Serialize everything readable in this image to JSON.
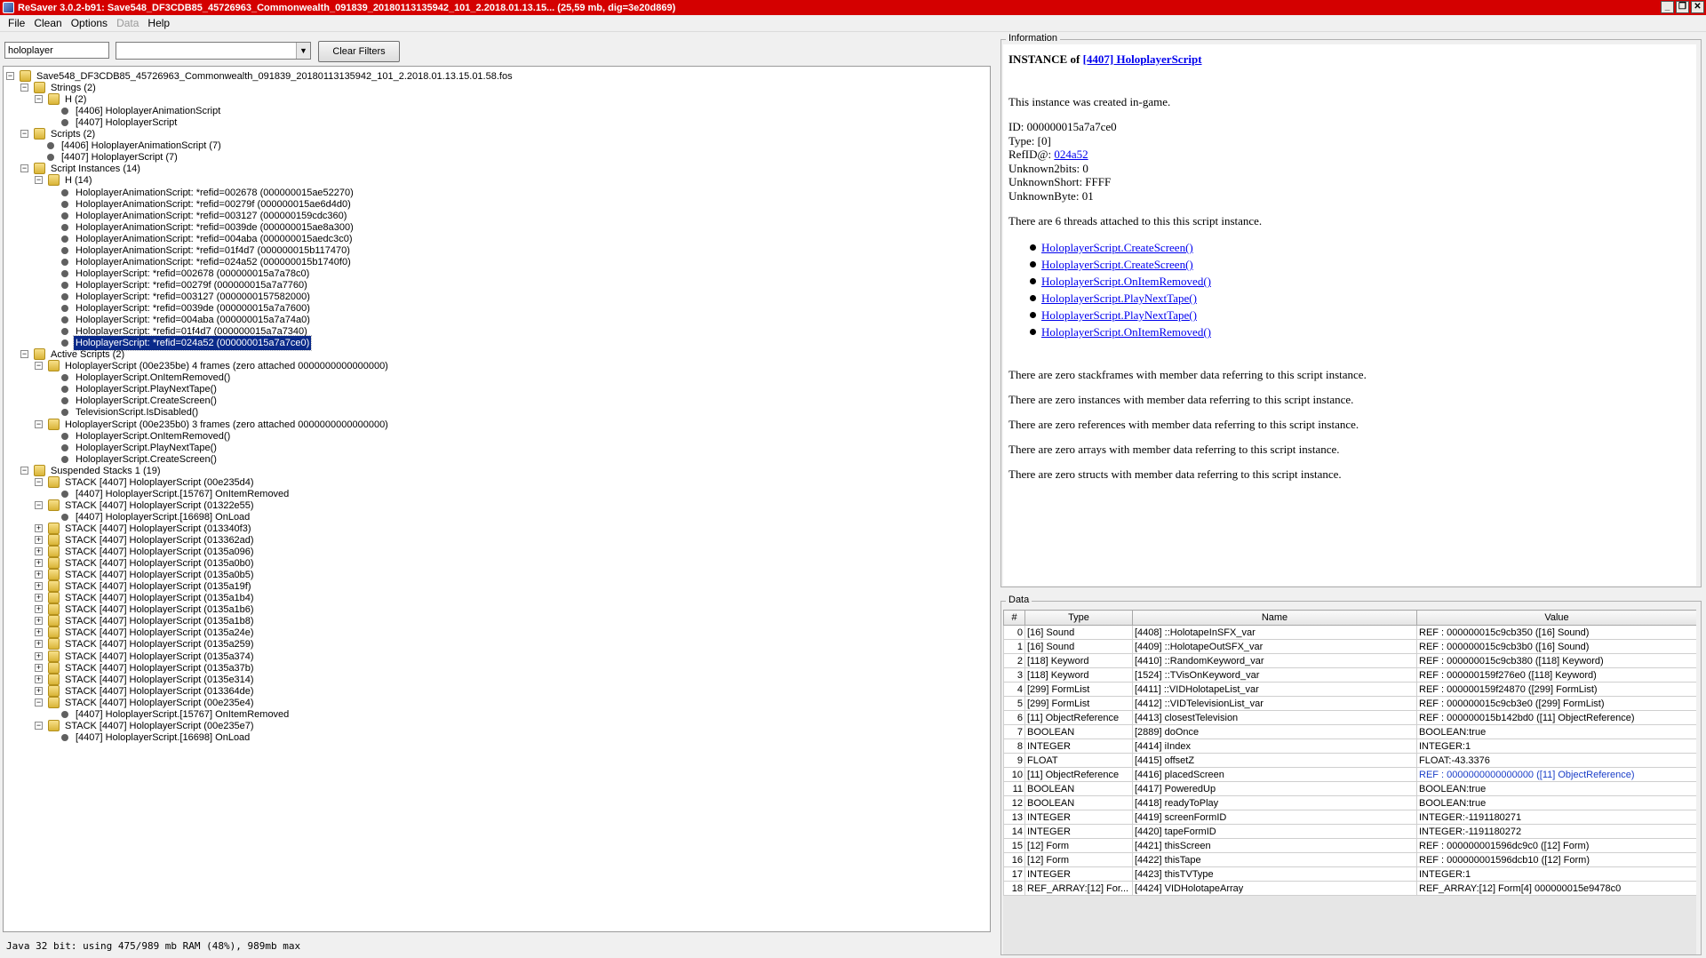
{
  "window": {
    "title": "ReSaver 3.0.2-b91: Save548_DF3CDB85_45726963_Commonwealth_091839_20180113135942_101_2.2018.01.13.15... (25,59 mb, dig=3e20d869)",
    "controls": [
      "_",
      "❐",
      "✕"
    ]
  },
  "menu": [
    {
      "label": "File",
      "enabled": true
    },
    {
      "label": "Clean",
      "enabled": true
    },
    {
      "label": "Options",
      "enabled": true
    },
    {
      "label": "Data",
      "enabled": false
    },
    {
      "label": "Help",
      "enabled": true
    }
  ],
  "filter": {
    "value": "holoplayer",
    "select_value": "",
    "clear_label": "Clear Filters"
  },
  "tree": [
    {
      "d": 0,
      "t": "f",
      "e": "-",
      "l": "Save548_DF3CDB85_45726963_Commonwealth_091839_20180113135942_101_2.2018.01.13.15.01.58.fos"
    },
    {
      "d": 1,
      "t": "f",
      "e": "-",
      "l": "Strings (2)"
    },
    {
      "d": 2,
      "t": "f",
      "e": "-",
      "l": "H (2)"
    },
    {
      "d": 3,
      "t": "l",
      "l": "[4406] HoloplayerAnimationScript"
    },
    {
      "d": 3,
      "t": "l",
      "l": "[4407] HoloplayerScript"
    },
    {
      "d": 1,
      "t": "f",
      "e": "-",
      "l": "Scripts (2)"
    },
    {
      "d": 2,
      "t": "l",
      "l": "[4406] HoloplayerAnimationScript (7)"
    },
    {
      "d": 2,
      "t": "l",
      "l": "[4407] HoloplayerScript (7)"
    },
    {
      "d": 1,
      "t": "f",
      "e": "-",
      "l": "Script Instances (14)"
    },
    {
      "d": 2,
      "t": "f",
      "e": "-",
      "l": "H (14)"
    },
    {
      "d": 3,
      "t": "l",
      "l": "HoloplayerAnimationScript: *refid=002678 (000000015ae52270)"
    },
    {
      "d": 3,
      "t": "l",
      "l": "HoloplayerAnimationScript: *refid=00279f (000000015ae6d4d0)"
    },
    {
      "d": 3,
      "t": "l",
      "l": "HoloplayerAnimationScript: *refid=003127 (000000159cdc360)"
    },
    {
      "d": 3,
      "t": "l",
      "l": "HoloplayerAnimationScript: *refid=0039de (000000015ae8a300)"
    },
    {
      "d": 3,
      "t": "l",
      "l": "HoloplayerAnimationScript: *refid=004aba (000000015aedc3c0)"
    },
    {
      "d": 3,
      "t": "l",
      "l": "HoloplayerAnimationScript: *refid=01f4d7 (000000015b117470)"
    },
    {
      "d": 3,
      "t": "l",
      "l": "HoloplayerAnimationScript: *refid=024a52 (000000015b1740f0)"
    },
    {
      "d": 3,
      "t": "l",
      "l": "HoloplayerScript: *refid=002678 (000000015a7a78c0)"
    },
    {
      "d": 3,
      "t": "l",
      "l": "HoloplayerScript: *refid=00279f (000000015a7a7760)"
    },
    {
      "d": 3,
      "t": "l",
      "l": "HoloplayerScript: *refid=003127 (0000000157582000)"
    },
    {
      "d": 3,
      "t": "l",
      "l": "HoloplayerScript: *refid=0039de (000000015a7a7600)"
    },
    {
      "d": 3,
      "t": "l",
      "l": "HoloplayerScript: *refid=004aba (000000015a7a74a0)"
    },
    {
      "d": 3,
      "t": "l",
      "l": "HoloplayerScript: *refid=01f4d7 (000000015a7a7340)"
    },
    {
      "d": 3,
      "t": "l",
      "l": "HoloplayerScript: *refid=024a52 (000000015a7a7ce0)",
      "sel": true
    },
    {
      "d": 1,
      "t": "f",
      "e": "-",
      "l": "Active Scripts (2)"
    },
    {
      "d": 2,
      "t": "f",
      "e": "-",
      "l": "HoloplayerScript (00e235be) 4 frames (zero attached 0000000000000000)"
    },
    {
      "d": 3,
      "t": "l",
      "l": "HoloplayerScript.OnItemRemoved()"
    },
    {
      "d": 3,
      "t": "l",
      "l": "HoloplayerScript.PlayNextTape()"
    },
    {
      "d": 3,
      "t": "l",
      "l": "HoloplayerScript.CreateScreen()"
    },
    {
      "d": 3,
      "t": "l",
      "l": "TelevisionScript.IsDisabled()"
    },
    {
      "d": 2,
      "t": "f",
      "e": "-",
      "l": "HoloplayerScript (00e235b0) 3 frames (zero attached 0000000000000000)"
    },
    {
      "d": 3,
      "t": "l",
      "l": "HoloplayerScript.OnItemRemoved()"
    },
    {
      "d": 3,
      "t": "l",
      "l": "HoloplayerScript.PlayNextTape()"
    },
    {
      "d": 3,
      "t": "l",
      "l": "HoloplayerScript.CreateScreen()"
    },
    {
      "d": 1,
      "t": "f",
      "e": "-",
      "l": "Suspended Stacks 1 (19)"
    },
    {
      "d": 2,
      "t": "f",
      "e": "-",
      "l": "STACK [4407] HoloplayerScript (00e235d4)"
    },
    {
      "d": 3,
      "t": "l",
      "l": "[4407] HoloplayerScript.[15767] OnItemRemoved"
    },
    {
      "d": 2,
      "t": "f",
      "e": "-",
      "l": "STACK [4407] HoloplayerScript (01322e55)"
    },
    {
      "d": 3,
      "t": "l",
      "l": "[4407] HoloplayerScript.[16698] OnLoad"
    },
    {
      "d": 2,
      "t": "f",
      "e": "+",
      "l": "STACK [4407] HoloplayerScript (013340f3)"
    },
    {
      "d": 2,
      "t": "f",
      "e": "+",
      "l": "STACK [4407] HoloplayerScript (013362ad)"
    },
    {
      "d": 2,
      "t": "f",
      "e": "+",
      "l": "STACK [4407] HoloplayerScript (0135a096)"
    },
    {
      "d": 2,
      "t": "f",
      "e": "+",
      "l": "STACK [4407] HoloplayerScript (0135a0b0)"
    },
    {
      "d": 2,
      "t": "f",
      "e": "+",
      "l": "STACK [4407] HoloplayerScript (0135a0b5)"
    },
    {
      "d": 2,
      "t": "f",
      "e": "+",
      "l": "STACK [4407] HoloplayerScript (0135a19f)"
    },
    {
      "d": 2,
      "t": "f",
      "e": "+",
      "l": "STACK [4407] HoloplayerScript (0135a1b4)"
    },
    {
      "d": 2,
      "t": "f",
      "e": "+",
      "l": "STACK [4407] HoloplayerScript (0135a1b6)"
    },
    {
      "d": 2,
      "t": "f",
      "e": "+",
      "l": "STACK [4407] HoloplayerScript (0135a1b8)"
    },
    {
      "d": 2,
      "t": "f",
      "e": "+",
      "l": "STACK [4407] HoloplayerScript (0135a24e)"
    },
    {
      "d": 2,
      "t": "f",
      "e": "+",
      "l": "STACK [4407] HoloplayerScript (0135a259)"
    },
    {
      "d": 2,
      "t": "f",
      "e": "+",
      "l": "STACK [4407] HoloplayerScript (0135a374)"
    },
    {
      "d": 2,
      "t": "f",
      "e": "+",
      "l": "STACK [4407] HoloplayerScript (0135a37b)"
    },
    {
      "d": 2,
      "t": "f",
      "e": "+",
      "l": "STACK [4407] HoloplayerScript (0135e314)"
    },
    {
      "d": 2,
      "t": "f",
      "e": "+",
      "l": "STACK [4407] HoloplayerScript (013364de)"
    },
    {
      "d": 2,
      "t": "f",
      "e": "-",
      "l": "STACK [4407] HoloplayerScript (00e235e4)"
    },
    {
      "d": 3,
      "t": "l",
      "l": "[4407] HoloplayerScript.[15767] OnItemRemoved"
    },
    {
      "d": 2,
      "t": "f",
      "e": "-",
      "l": "STACK [4407] HoloplayerScript (00e235e7)"
    },
    {
      "d": 3,
      "t": "l",
      "l": "[4407] HoloplayerScript.[16698] OnLoad"
    }
  ],
  "status": "Java 32 bit: using 475/989 mb RAM (48%), 989mb max",
  "info": {
    "legend": "Information",
    "heading_prefix": "INSTANCE of ",
    "heading_link": "[4407] HoloplayerScript",
    "created": "This instance was created in-game.",
    "id": "ID: 000000015a7a7ce0",
    "type": "Type: [0]",
    "refid_prefix": "RefID@: ",
    "refid_link": "024a52",
    "unknown2bits": "Unknown2bits: 0",
    "unknownshort": "UnknownShort: FFFF",
    "unknownbyte": "UnknownByte: 01",
    "threads_text": "There are 6 threads attached to this this script instance.",
    "threads": [
      "HoloplayerScript.CreateScreen()",
      "HoloplayerScript.CreateScreen()",
      "HoloplayerScript.OnItemRemoved()",
      "HoloplayerScript.PlayNextTape()",
      "HoloplayerScript.PlayNextTape()",
      "HoloplayerScript.OnItemRemoved()"
    ],
    "zero_stackframes": "There are zero stackframes with member data referring to this script instance.",
    "zero_instances": "There are zero instances with member data referring to this script instance.",
    "zero_references": "There are zero references with member data referring to this script instance.",
    "zero_arrays": "There are zero arrays with member data referring to this script instance.",
    "zero_structs": "There are zero structs with member data referring to this script instance."
  },
  "data": {
    "legend": "Data",
    "columns": [
      "#",
      "Type",
      "Name",
      "Value"
    ],
    "rows": [
      [
        "0",
        "[16] Sound",
        "[4408] ::HolotapeInSFX_var",
        "REF : 000000015c9cb350 ([16] Sound)"
      ],
      [
        "1",
        "[16] Sound",
        "[4409] ::HolotapeOutSFX_var",
        "REF : 000000015c9cb3b0 ([16] Sound)"
      ],
      [
        "2",
        "[118] Keyword",
        "[4410] ::RandomKeyword_var",
        "REF : 000000015c9cb380 ([118] Keyword)"
      ],
      [
        "3",
        "[118] Keyword",
        "[1524] ::TVisOnKeyword_var",
        "REF : 000000159f276e0 ([118] Keyword)"
      ],
      [
        "4",
        "[299] FormList",
        "[4411] ::VIDHolotapeList_var",
        "REF : 000000159f24870 ([299] FormList)"
      ],
      [
        "5",
        "[299] FormList",
        "[4412] ::VIDTelevisionList_var",
        "REF : 000000015c9cb3e0 ([299] FormList)"
      ],
      [
        "6",
        "[11] ObjectReference",
        "[4413] closestTelevision",
        "REF : 000000015b142bd0 ([11] ObjectReference)"
      ],
      [
        "7",
        "BOOLEAN",
        "[2889] doOnce",
        "BOOLEAN:true"
      ],
      [
        "8",
        "INTEGER",
        "[4414] iIndex",
        "INTEGER:1"
      ],
      [
        "9",
        "FLOAT",
        "[4415] offsetZ",
        "FLOAT:-43.3376"
      ],
      [
        "10",
        "[11] ObjectReference",
        "[4416] placedScreen",
        "REF : 0000000000000000 ([11] ObjectReference)"
      ],
      [
        "11",
        "BOOLEAN",
        "[4417] PoweredUp",
        "BOOLEAN:true"
      ],
      [
        "12",
        "BOOLEAN",
        "[4418] readyToPlay",
        "BOOLEAN:true"
      ],
      [
        "13",
        "INTEGER",
        "[4419] screenFormID",
        "INTEGER:-1191180271"
      ],
      [
        "14",
        "INTEGER",
        "[4420] tapeFormID",
        "INTEGER:-1191180272"
      ],
      [
        "15",
        "[12] Form",
        "[4421] thisScreen",
        "REF : 000000001596dc9c0 ([12] Form)"
      ],
      [
        "16",
        "[12] Form",
        "[4422] thisTape",
        "REF : 000000001596dcb10 ([12] Form)"
      ],
      [
        "17",
        "INTEGER",
        "[4423] thisTVType",
        "INTEGER:1"
      ],
      [
        "18",
        "REF_ARRAY:[12] For...",
        "[4424] VIDHolotapeArray",
        "REF_ARRAY:[12] Form[4] 000000015e9478c0"
      ]
    ],
    "link_row": 10
  }
}
